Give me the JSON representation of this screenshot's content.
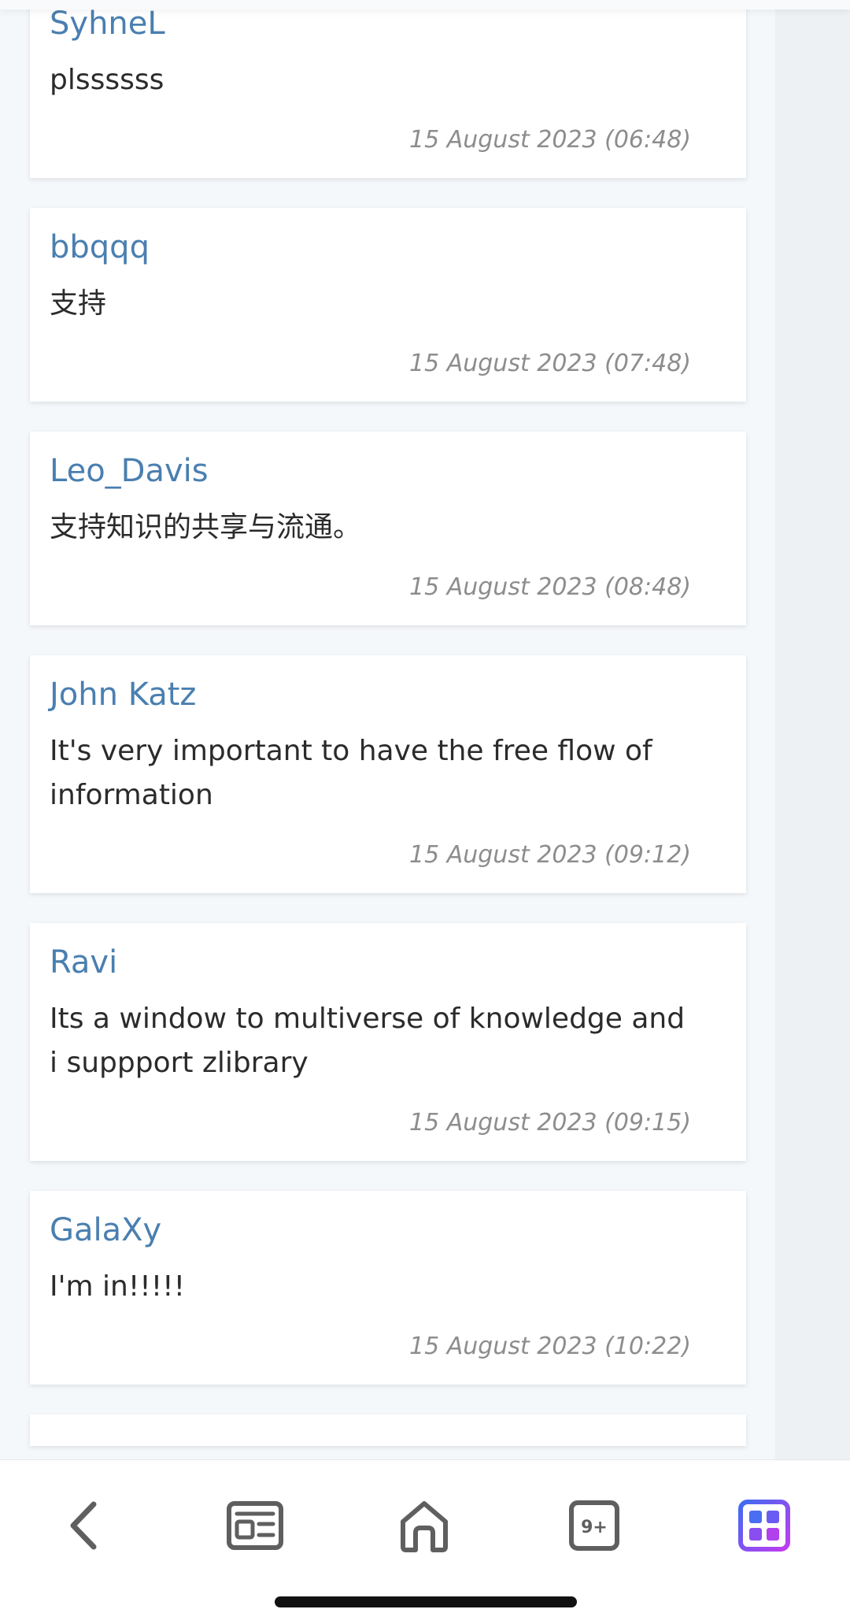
{
  "comments": [
    {
      "author": "SyhneL",
      "text": "plssssss",
      "date": "15 August 2023 (06:48)"
    },
    {
      "author": "bbqqq",
      "text": "支持",
      "date": "15 August 2023 (07:48)"
    },
    {
      "author": "Leo_Davis",
      "text": "支持知识的共享与流通。",
      "date": "15 August 2023 (08:48)"
    },
    {
      "author": "John Katz",
      "text": "It's very important to have the free flow of information",
      "date": "15 August 2023 (09:12)"
    },
    {
      "author": "Ravi",
      "text": "Its a window to multiverse of knowledge and i suppport zlibrary",
      "date": "15 August 2023 (09:15)"
    },
    {
      "author": "GalaXy",
      "text": "I'm in!!!!!",
      "date": "15 August 2023 (10:22)"
    }
  ],
  "bottom_nav": {
    "back_icon": "chevron-left-icon",
    "news_icon": "newspaper-icon",
    "home_icon": "home-icon",
    "tabs_icon": "tabs-count-icon",
    "tabs_count": "9+",
    "apps_icon": "apps-grid-icon"
  },
  "colors": {
    "author": "#4a7fb0",
    "text": "#2b2b2b",
    "date": "#8d8d8d",
    "apps_gradient_start": "#3f6cf0",
    "apps_gradient_end": "#c23cf0"
  }
}
